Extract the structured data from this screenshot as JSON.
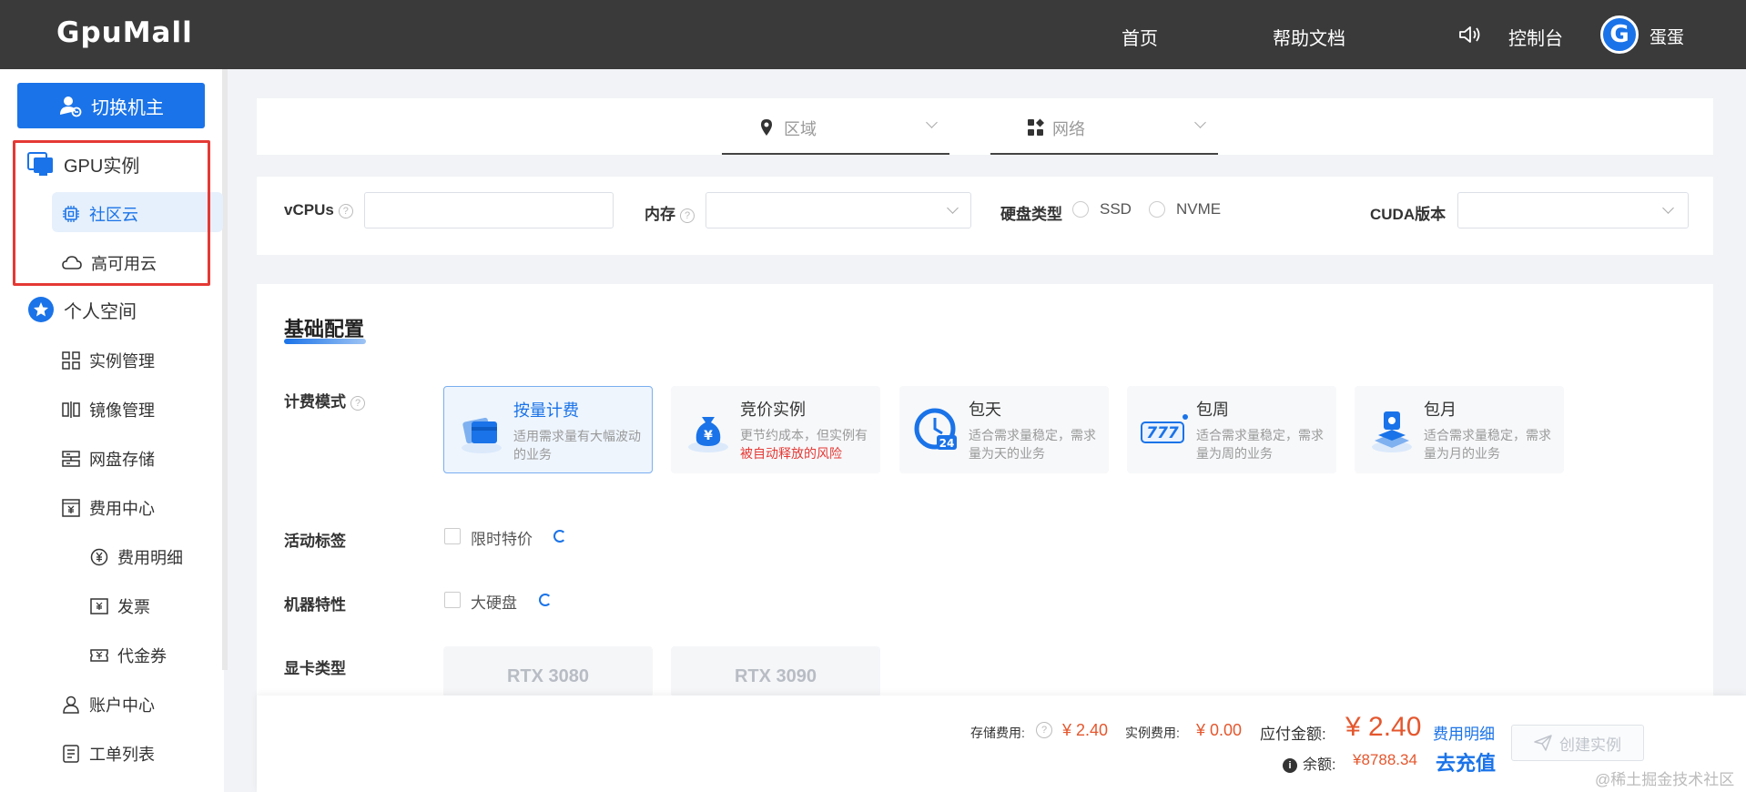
{
  "header": {
    "logo": "GpuMall",
    "nav_home": "首页",
    "nav_docs": "帮助文档",
    "nav_console": "控制台",
    "avatar_letter": "G",
    "username": "蛋蛋"
  },
  "sidebar": {
    "switch_button": "切换机主",
    "gpu_instances": "GPU实例",
    "community_cloud": "社区云",
    "ha_cloud": "高可用云",
    "personal_space": "个人空间",
    "instance_mgmt": "实例管理",
    "image_mgmt": "镜像管理",
    "disk_storage": "网盘存储",
    "billing_center": "费用中心",
    "billing_details": "费用明细",
    "invoice": "发票",
    "voucher": "代金券",
    "account_center": "账户中心",
    "ticket_list": "工单列表"
  },
  "filters": {
    "region_placeholder": "区域",
    "network_placeholder": "网络",
    "vcpus_label": "vCPUs",
    "memory_label": "内存",
    "disk_type_label": "硬盘类型",
    "disk_ssd": "SSD",
    "disk_nvme": "NVME",
    "cuda_label": "CUDA版本"
  },
  "config": {
    "section_title": "基础配置",
    "billing_mode_label": "计费模式",
    "activity_tag_label": "活动标签",
    "machine_feature_label": "机器特性",
    "gpu_type_label": "显卡类型",
    "limited_offer": "限时特价",
    "large_disk": "大硬盘",
    "billing_cards": [
      {
        "title": "按量计费",
        "desc": "适用需求量有大幅波动的业务",
        "desc_red": ""
      },
      {
        "title": "竞价实例",
        "desc": "更节约成本，但实例有",
        "desc_red": "被自动释放的风险"
      },
      {
        "title": "包天",
        "desc": "适合需求量稳定，需求量为天的业务",
        "desc_red": ""
      },
      {
        "title": "包周",
        "desc": "适合需求量稳定，需求量为周的业务",
        "desc_red": ""
      },
      {
        "title": "包月",
        "desc": "适合需求量稳定，需求量为月的业务",
        "desc_red": ""
      }
    ],
    "gpu_options": [
      "RTX 3080",
      "RTX 3090"
    ]
  },
  "footer": {
    "storage_fee_label": "存储费用:",
    "storage_fee": "¥ 2.40",
    "instance_fee_label": "实例费用:",
    "instance_fee": "¥ 0.00",
    "payable_label": "应付金额:",
    "payable": "¥ 2.40",
    "fee_details_link": "费用明细",
    "balance_label": "余额:",
    "balance": "¥8788.34",
    "recharge_link": "去充值",
    "create_button": "创建实例",
    "watermark": "@稀土掘金技术社区"
  },
  "colors": {
    "accent": "#1a73e8",
    "topbar": "#3a3a3a",
    "highlight_box": "#e53935",
    "price_red": "#e4572e"
  },
  "selected_billing_mode": "按量计费"
}
